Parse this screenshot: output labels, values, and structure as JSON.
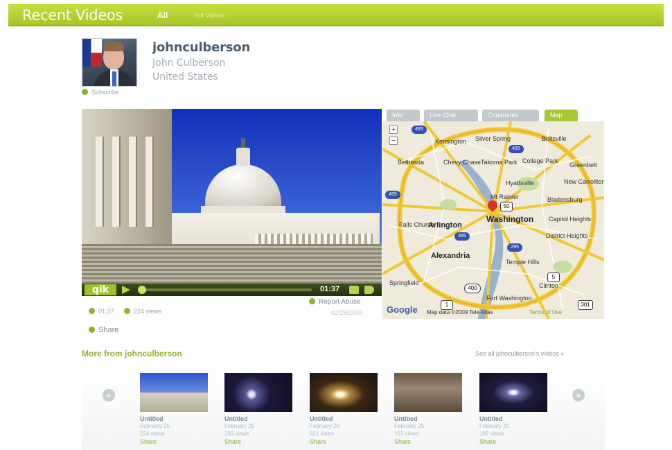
{
  "header": {
    "title": "Recent Videos",
    "tabs": [
      {
        "label": "All",
        "active": true
      },
      {
        "label": "Hot Videos",
        "active": false
      }
    ],
    "accent": "#a9c72a"
  },
  "profile": {
    "username": "johnculberson",
    "full_name": "John Culberson",
    "country": "United States",
    "subscribe_label": "Subscribe"
  },
  "player": {
    "logo": "qik",
    "time": "01:37",
    "progress": 0.02
  },
  "video_meta": {
    "duration": "01:37",
    "views": "224 views",
    "report_label": "Report Abuse",
    "date": "02/25/2009",
    "share_label": "Share"
  },
  "panel_tabs": [
    {
      "label": "Info",
      "active": false
    },
    {
      "label": "Live Chat",
      "active": false
    },
    {
      "label": "Comments",
      "active": false
    },
    {
      "label": "Map",
      "active": true
    }
  ],
  "map": {
    "labels": {
      "kensington": "Kensington",
      "silver_spring": "Silver Spring",
      "beltsville": "Beltsville",
      "bethesda": "Bethesda",
      "chevy_chase": "Chevy Chase",
      "takoma_park": "Takoma Park",
      "college_park": "College Park",
      "greenbelt": "Greenbelt",
      "hyattsville": "Hyattsville",
      "new_carrollton": "New Carrollton",
      "mt_rainier": "Mt Rainier",
      "bladensburg": "Bladensburg",
      "washington": "Washington",
      "capitol_heights": "Capitol Heights",
      "district_heights": "District Heights",
      "falls_church": "Falls Church",
      "arlington": "Arlington",
      "alexandria": "Alexandria",
      "temple_hills": "Temple Hills",
      "clinton": "Clinton",
      "fort_washington": "Fort Washington",
      "springfield": "Springfield"
    },
    "shields": {
      "i495_a": "495",
      "i495_b": "495",
      "i495_c": "495",
      "i295": "295",
      "i395": "395",
      "us50": "50",
      "us1": "1",
      "rt5": "5",
      "rt400": "400",
      "rt301": "301"
    },
    "google_label": "Google",
    "copyright": "Map data ©2009 Tele Atlas",
    "terms_link": "Terms of Use"
  },
  "more": {
    "title": "More from johnculberson",
    "see_all": "See all johnculberson's videos »",
    "prev_icon": "«",
    "next_icon": "»",
    "items": [
      {
        "title": "Untitled",
        "date": "February 25",
        "views": "224 views",
        "share": "Share",
        "theme": "day"
      },
      {
        "title": "Untitled",
        "date": "February 25",
        "views": "383 views",
        "share": "Share",
        "theme": "night"
      },
      {
        "title": "Untitled",
        "date": "February 25",
        "views": "821 views",
        "share": "Share",
        "theme": "night"
      },
      {
        "title": "Untitled",
        "date": "February 25",
        "views": "163 views",
        "share": "Share",
        "theme": "indoor"
      },
      {
        "title": "Untitled",
        "date": "February 25",
        "views": "182 views",
        "share": "Share",
        "theme": "night"
      }
    ]
  }
}
